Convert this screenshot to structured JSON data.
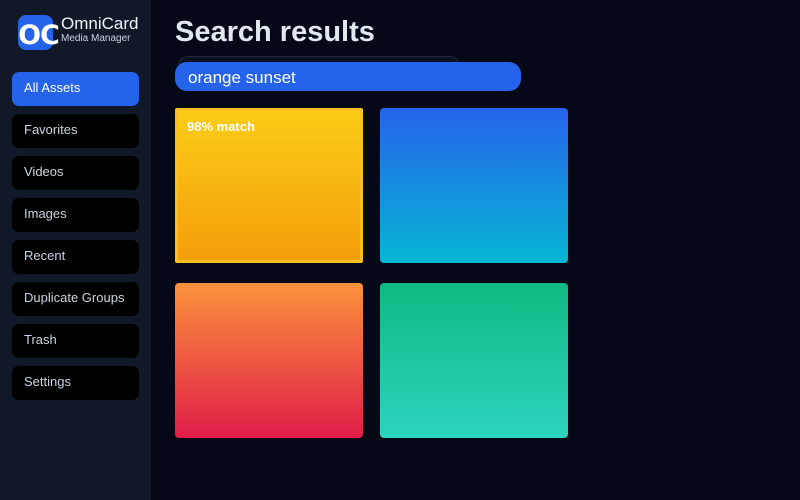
{
  "app": {
    "logo_text": "OC",
    "name": "OmniCard",
    "subtitle": "Media Manager"
  },
  "sidebar": {
    "items": [
      {
        "label": "All Assets",
        "active": true
      },
      {
        "label": "Favorites",
        "active": false
      },
      {
        "label": "Videos",
        "active": false
      },
      {
        "label": "Images",
        "active": false
      },
      {
        "label": "Recent",
        "active": false
      },
      {
        "label": "Duplicate Groups",
        "active": false
      },
      {
        "label": "Trash",
        "active": false
      },
      {
        "label": "Settings",
        "active": false
      }
    ]
  },
  "main": {
    "title": "Search results",
    "search": {
      "value": "orange sunset"
    },
    "results": [
      {
        "label": "98% match",
        "gradient": [
          "#facc15",
          "#f59e0b"
        ],
        "selected": true
      },
      {
        "label": "",
        "gradient": [
          "#2563eb",
          "#06b6d4"
        ],
        "selected": false
      },
      {
        "label": "",
        "gradient": [
          "#fb923c",
          "#e11d48"
        ],
        "selected": false
      },
      {
        "label": "",
        "gradient": [
          "#10b981",
          "#2dd4bf"
        ],
        "selected": false
      }
    ]
  },
  "colors": {
    "accent": "#2563eb",
    "background": "#050816",
    "sidebar": "#111827",
    "nav_item": "#000000",
    "selected_border": "#fbbf24"
  }
}
